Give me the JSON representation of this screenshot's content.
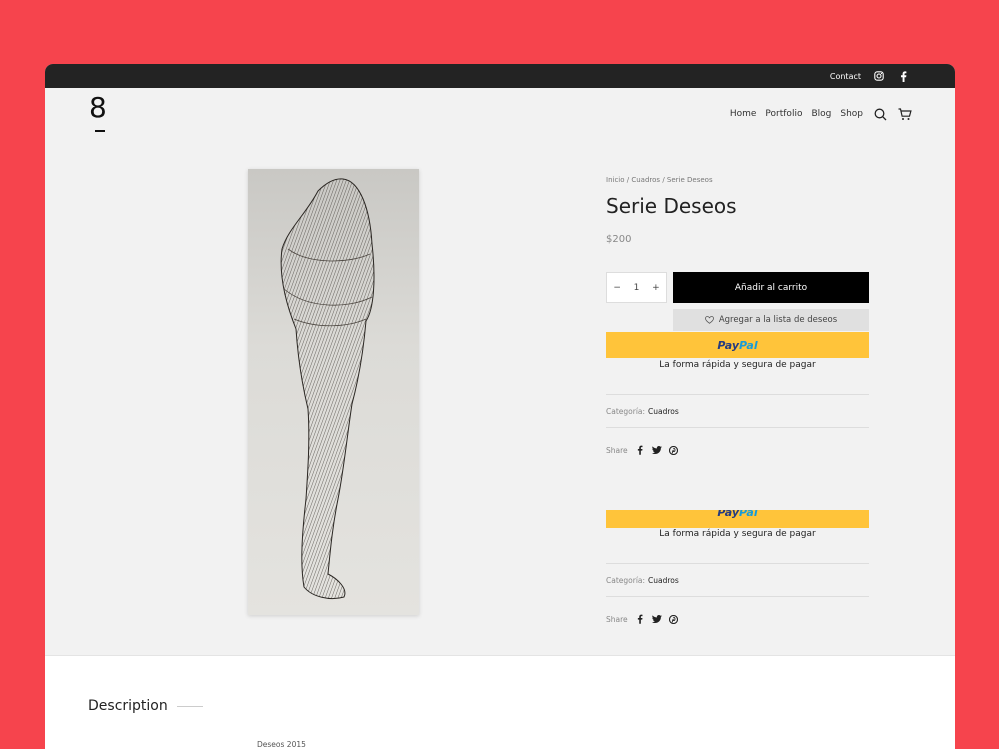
{
  "topbar": {
    "contact": "Contact",
    "icons": [
      "instagram-icon",
      "facebook-icon"
    ]
  },
  "header": {
    "logo": "8",
    "nav": [
      "Home",
      "Portfolio",
      "Blog",
      "Shop"
    ],
    "icons": [
      "search-icon",
      "cart-icon"
    ]
  },
  "product": {
    "breadcrumb": [
      "Inicio",
      "Cuadros",
      "Serie Deseos"
    ],
    "breadcrumb_sep": "/",
    "title": "Serie Deseos",
    "price": "$200",
    "quantity": "1",
    "minus": "−",
    "plus": "+",
    "add_to_cart": "Añadir al carrito",
    "wishlist": "Agregar a la lista de deseos",
    "paypal_pay": "Pay",
    "paypal_pal": "Pal",
    "paypal_tagline": "La forma rápida y segura de pagar",
    "category_label": "Categoría:",
    "category_value": "Cuadros",
    "share_label": "Share",
    "share_icons": [
      "facebook-icon",
      "twitter-icon",
      "pinterest-icon"
    ]
  },
  "description": {
    "title": "Description",
    "text": "Deseos 2015"
  },
  "colors": {
    "page_bg": "#f6444d",
    "topbar": "#232323",
    "paypal": "#ffc43a",
    "cart_button": "#000000"
  }
}
